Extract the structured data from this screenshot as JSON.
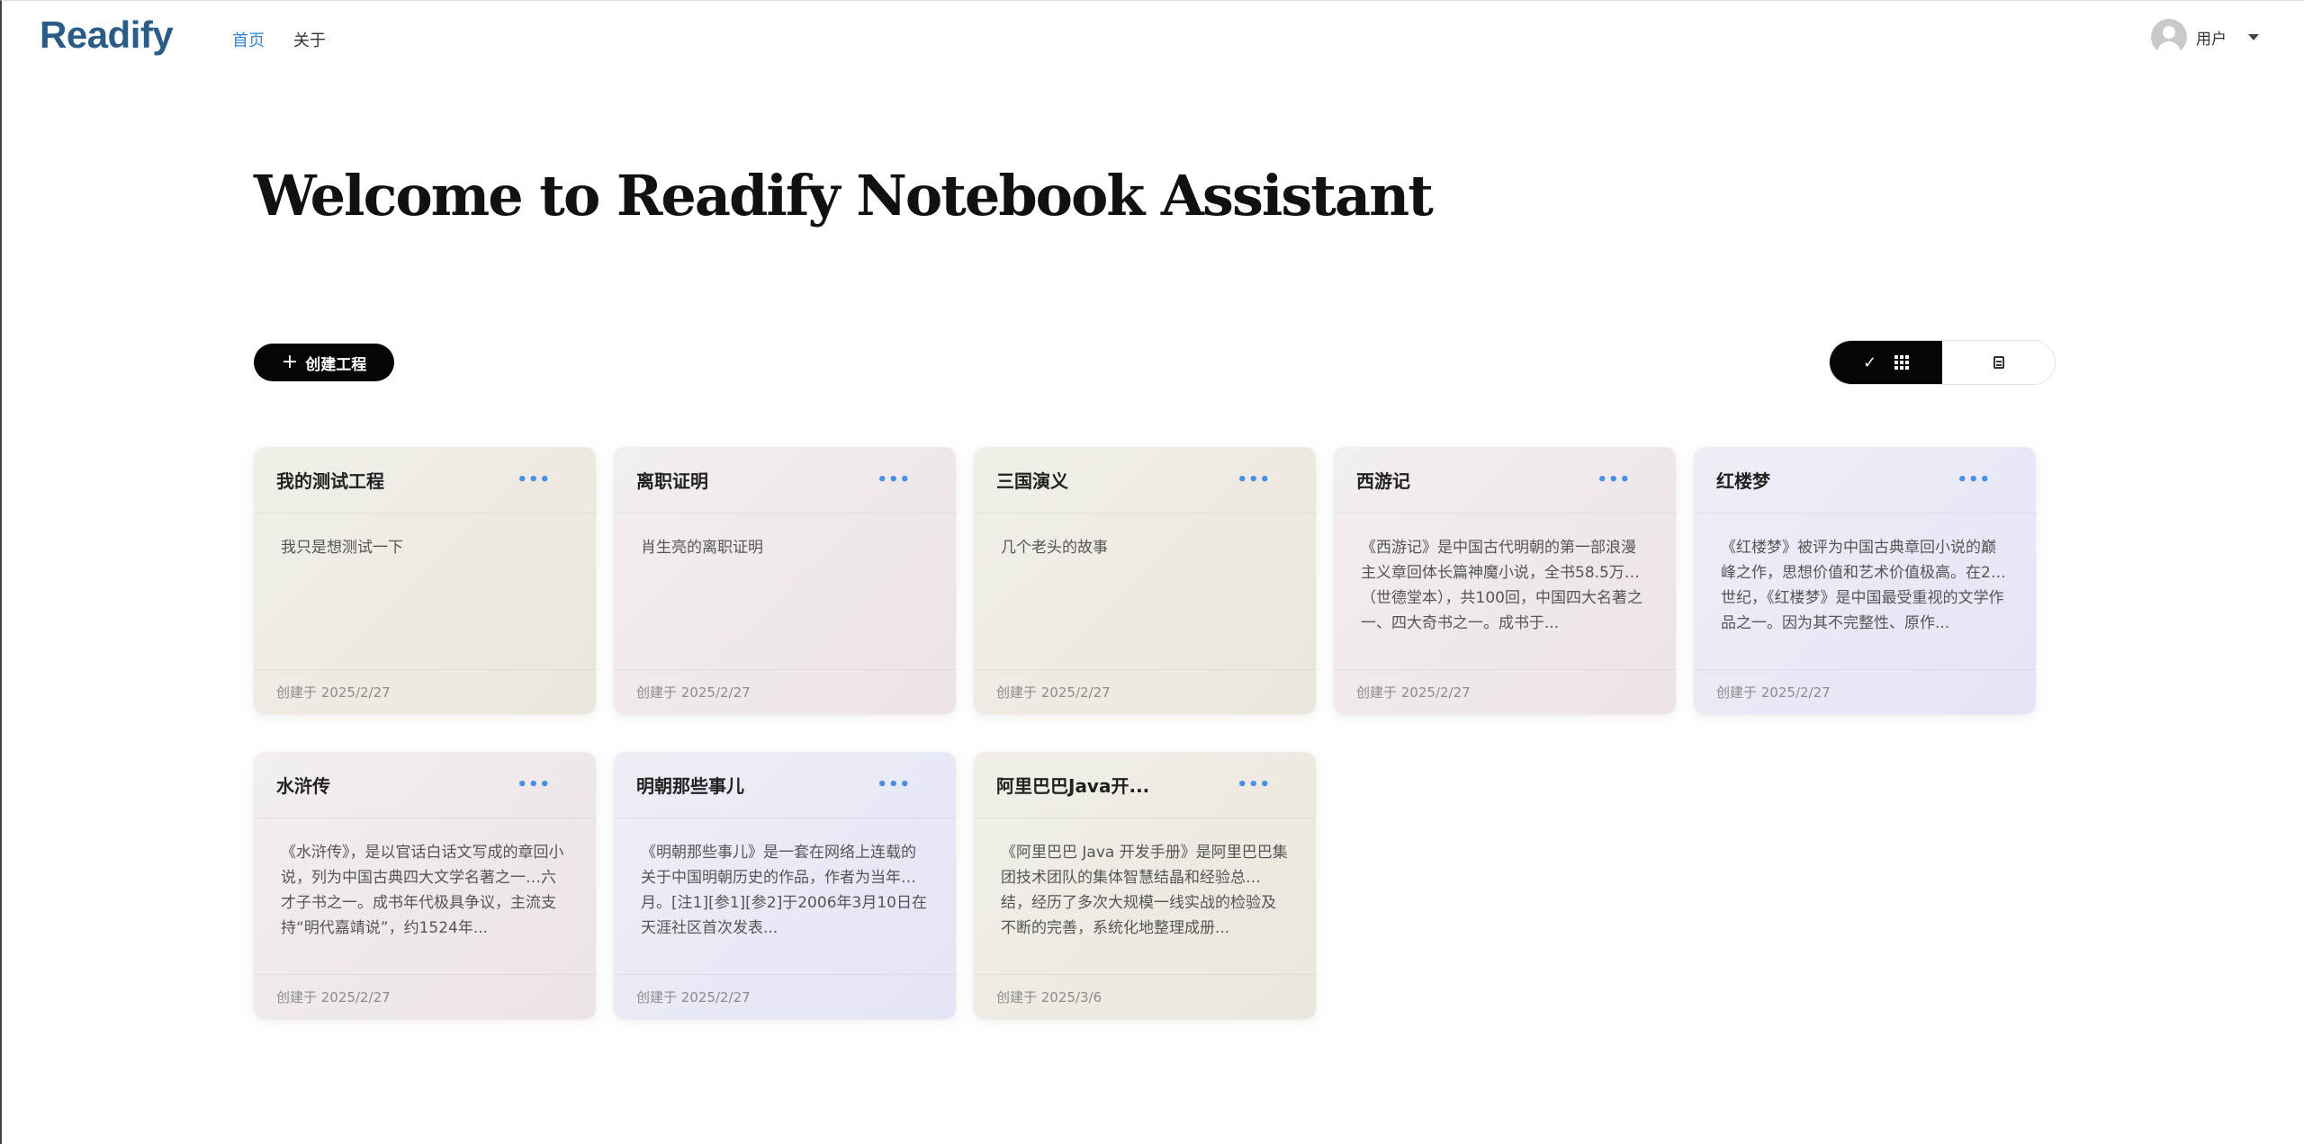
{
  "header": {
    "logo": "Readify",
    "nav": [
      {
        "label": "首页",
        "active": true
      },
      {
        "label": "关于",
        "active": false
      }
    ],
    "user": {
      "name": "用户",
      "icon": "user-avatar-icon"
    }
  },
  "main": {
    "title": "Welcome to Readify Notebook Assistant",
    "create_button": {
      "icon": "plus-icon",
      "label": "创建工程"
    },
    "view_toggle": {
      "selected": "grid",
      "options": [
        {
          "value": "grid",
          "icons": [
            "check-icon",
            "grid-icon"
          ]
        },
        {
          "value": "list",
          "icons": [
            "document-icon"
          ]
        }
      ]
    },
    "projects": [
      {
        "title": "我的测试工程",
        "description": "我只是想测试一下",
        "created": "创建于 2025/2/27",
        "tint": "beige"
      },
      {
        "title": "离职证明",
        "description": "肖生亮的离职证明",
        "created": "创建于 2025/2/27",
        "tint": "rose"
      },
      {
        "title": "三国演义",
        "description": "几个老头的故事",
        "created": "创建于 2025/2/27",
        "tint": "beige"
      },
      {
        "title": "西游记",
        "description": "《西游记》是中国古代明朝的第一部浪漫主义章回体长篇神魔小说，全书58.5万…（世德堂本），共100回，中国四大名著之一、四大奇书之一。成书于...",
        "created": "创建于 2025/2/27",
        "tint": "rose"
      },
      {
        "title": "红楼梦",
        "description": "《红楼梦》被评为中国古典章回小说的巅峰之作，思想价值和艺术价值极高。在2…世纪，《红楼梦》是中国最受重视的文学作品之一。因为其不完整性、原作...",
        "created": "创建于 2025/2/27",
        "tint": "lilac"
      },
      {
        "title": "水浒传",
        "description": "《水浒传》，是以官话白话文写成的章回小说，列为中国古典四大文学名著之一…六才子书之一。成书年代极具争议，主流支持“明代嘉靖说”，约1524年...",
        "created": "创建于 2025/2/27",
        "tint": "rose"
      },
      {
        "title": "明朝那些事儿",
        "description": "《明朝那些事儿》是一套在网络上连载的关于中国明朝历史的作品，作者为当年…月。[注1][参1][参2]于2006年3月10日在天涯社区首次发表...",
        "created": "创建于 2025/2/27",
        "tint": "lilac"
      },
      {
        "title": "阿里巴巴Java开...",
        "description": "《阿里巴巴 Java 开发手册》是阿里巴巴集团技术团队的集体智慧结晶和经验总…结，经历了多次大规模一线实战的检验及不断的完善，系统化地整理成册...",
        "created": "创建于 2025/3/6",
        "tint": "beige"
      }
    ],
    "more_icon": "more-horizontal-icon"
  },
  "colors": {
    "logo": "#2b5b87",
    "nav_active": "#2f86d6",
    "button_bg": "#050505",
    "more": "#4a8ede"
  }
}
